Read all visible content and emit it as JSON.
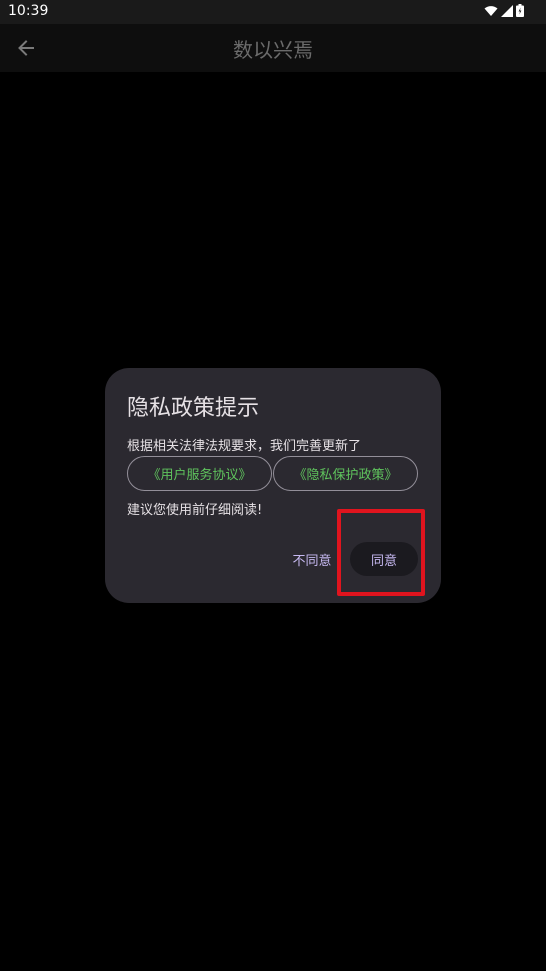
{
  "status_bar": {
    "time": "10:39",
    "icons": [
      "wifi-icon",
      "signal-icon",
      "battery-icon"
    ]
  },
  "app_bar": {
    "back_icon": "arrow-left-icon",
    "title": "数以兴焉"
  },
  "dialog": {
    "title": "隐私政策提示",
    "text_1": "根据相关法律法规要求，我们完善更新了",
    "link_user_agreement": "《用户服务协议》",
    "link_privacy_policy": "《隐私保护政策》",
    "text_2": "建议您使用前仔细阅读!",
    "disagree_label": "不同意",
    "agree_label": "同意"
  },
  "colors": {
    "background": "#000000",
    "dialog_bg": "#2b2930",
    "link_green": "#5fc35d",
    "action_purple": "#c6b8f0",
    "highlight_red": "#e0141e"
  }
}
